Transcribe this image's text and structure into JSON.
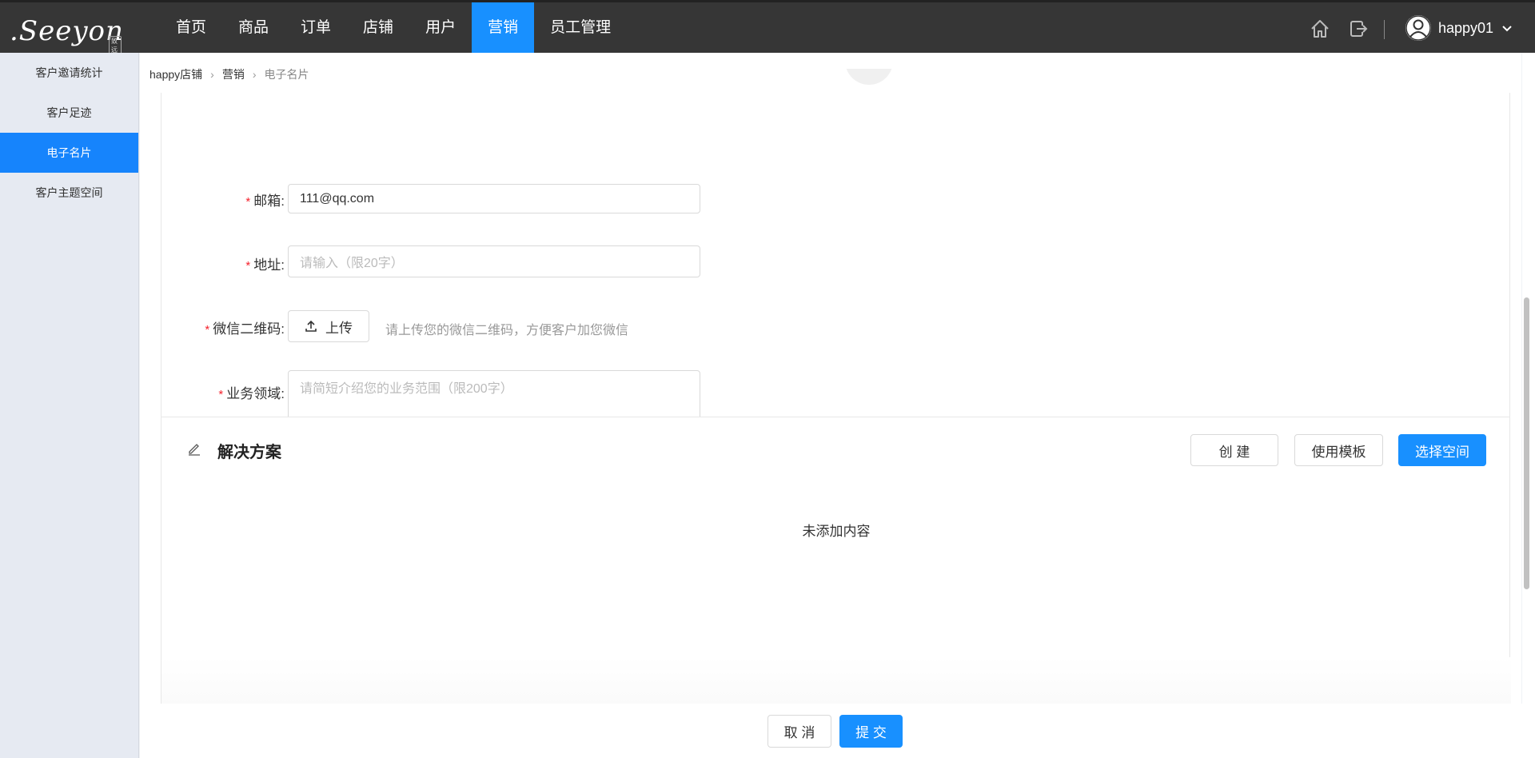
{
  "app": {
    "logo_text": ".Seeyon",
    "logo_badge": "致远"
  },
  "nav": {
    "items": [
      {
        "label": "首页"
      },
      {
        "label": "商品"
      },
      {
        "label": "订单"
      },
      {
        "label": "店铺"
      },
      {
        "label": "用户"
      },
      {
        "label": "营销",
        "active": true
      },
      {
        "label": "员工管理"
      }
    ]
  },
  "user": {
    "name": "happy01"
  },
  "sidebar": {
    "items": [
      {
        "label": "客户邀请统计"
      },
      {
        "label": "客户足迹"
      },
      {
        "label": "电子名片",
        "active": true
      },
      {
        "label": "客户主题空间"
      }
    ]
  },
  "breadcrumb": {
    "items": [
      "happy店铺",
      "营销",
      "电子名片"
    ]
  },
  "form": {
    "email": {
      "label": "邮箱:",
      "value": "111@qq.com"
    },
    "address": {
      "label": "地址:",
      "placeholder": "请输入（限20字）"
    },
    "wechat_qr": {
      "label": "微信二维码:",
      "button": "上传",
      "hint": "请上传您的微信二维码，方便客户加您微信"
    },
    "business": {
      "label": "业务领域:",
      "placeholder": "请简短介绍您的业务范围（限200字）"
    },
    "required_mark": "*"
  },
  "solutions": {
    "title": "解决方案",
    "create_button": "创 建",
    "template_button": "使用模板",
    "select_space_button": "选择空间",
    "empty_text": "未添加内容"
  },
  "footer": {
    "cancel": "取 消",
    "submit": "提 交"
  },
  "colors": {
    "primary": "#1890ff",
    "topbar": "#363636",
    "sidebar": "#e6eaf2",
    "required": "#f5222d"
  }
}
